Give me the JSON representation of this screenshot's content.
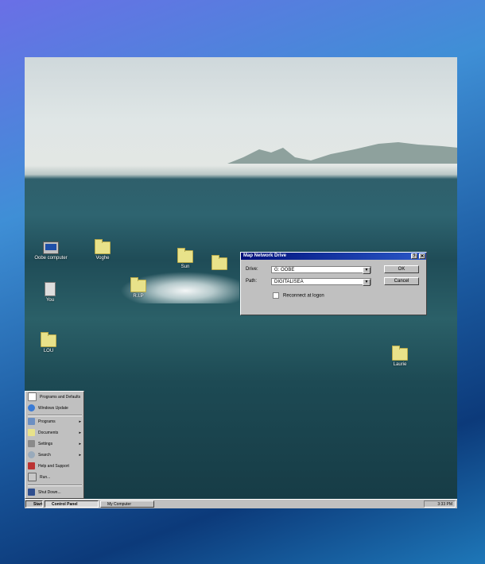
{
  "desktop": {
    "icons": [
      {
        "label": "Oobe computer",
        "icon": "computer-icon"
      },
      {
        "label": "Voghe",
        "icon": "folder-icon"
      },
      {
        "label": "Sun",
        "icon": "folder-icon"
      },
      {
        "label": "",
        "icon": "folder-icon"
      },
      {
        "label": "You",
        "icon": "recycle-bin-icon"
      },
      {
        "label": "R.I.P",
        "icon": "folder-icon"
      },
      {
        "label": "LOU",
        "icon": "folder-icon"
      },
      {
        "label": "Laurie",
        "icon": "folder-icon"
      }
    ]
  },
  "dialog": {
    "title": "Map Network Drive",
    "help_glyph": "?",
    "close_glyph": "✕",
    "drive_label": "Drive:",
    "drive_value": "G: OOBE",
    "path_label": "Path:",
    "path_value": "DIGITALISEA",
    "reconnect_label": "Reconnect at logon",
    "ok_label": "OK",
    "cancel_label": "Cancel",
    "dropdown_glyph": "▼"
  },
  "start_menu": {
    "items": [
      {
        "label": "Programs and Defaults",
        "icon": "programs-defaults-icon",
        "submenu": false
      },
      {
        "label": "Windows Update",
        "icon": "globe-icon",
        "submenu": false
      },
      {
        "label": "Programs",
        "icon": "programs-icon",
        "submenu": true
      },
      {
        "label": "Documents",
        "icon": "documents-icon",
        "submenu": true
      },
      {
        "label": "Settings",
        "icon": "settings-icon",
        "submenu": true
      },
      {
        "label": "Search",
        "icon": "search-icon",
        "submenu": true
      },
      {
        "label": "Help and Support",
        "icon": "help-book-icon",
        "submenu": false
      },
      {
        "label": "Run...",
        "icon": "run-icon",
        "submenu": false
      },
      {
        "label": "Shut Down...",
        "icon": "shutdown-icon",
        "submenu": false
      }
    ],
    "submenu_glyph": "▸"
  },
  "taskbar": {
    "start_label": "Start",
    "buttons": [
      {
        "label": "Control Panel",
        "active": true
      },
      {
        "label": "My Computer",
        "active": false
      }
    ],
    "clock": "3:33 PM"
  }
}
